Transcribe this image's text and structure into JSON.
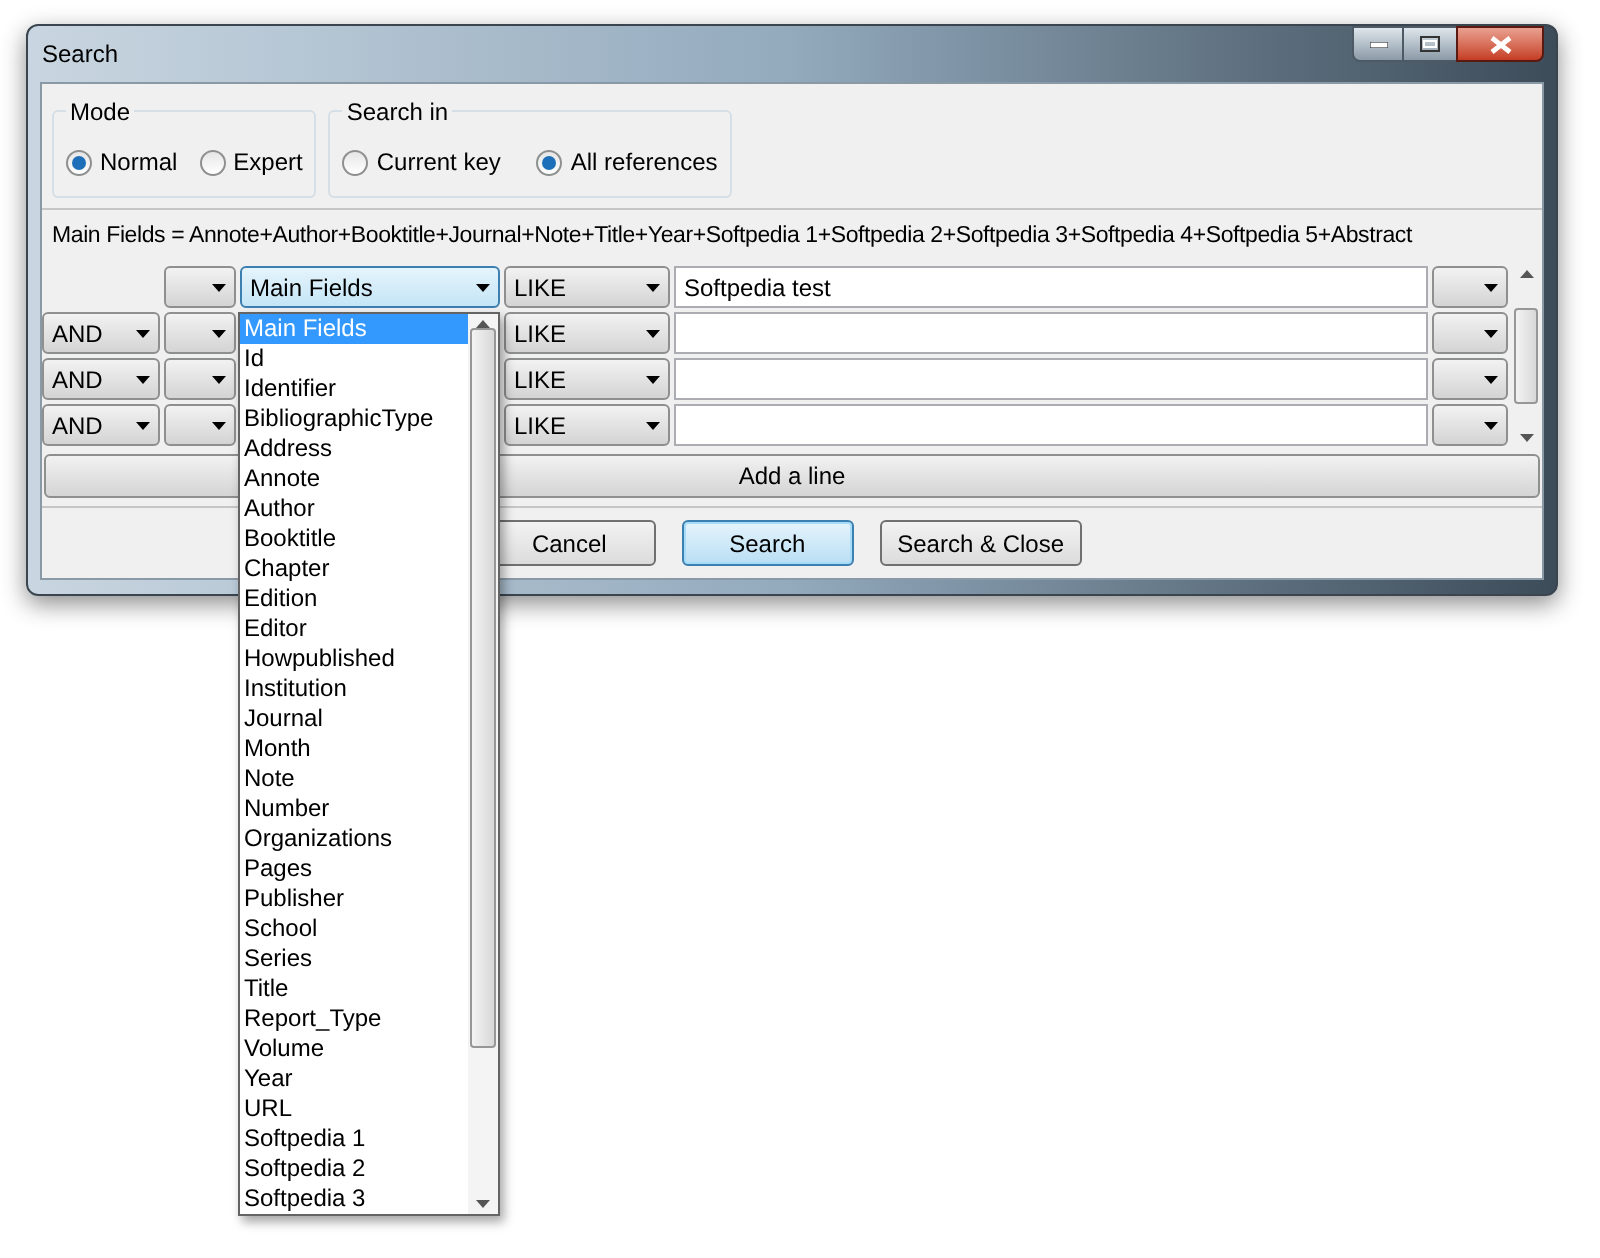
{
  "window": {
    "title": "Search"
  },
  "mode": {
    "label": "Mode",
    "options": [
      {
        "label": "Normal",
        "selected": true
      },
      {
        "label": "Expert",
        "selected": false
      }
    ]
  },
  "search_in": {
    "label": "Search in",
    "options": [
      {
        "label": "Current key",
        "selected": false
      },
      {
        "label": "All references",
        "selected": true
      }
    ]
  },
  "main_fields_line": "Main Fields = Annote+Author+Booktitle+Journal+Note+Title+Year+Softpedia 1+Softpedia 2+Softpedia 3+Softpedia 4+Softpedia 5+Abstract",
  "rows": [
    {
      "field": "Main Fields",
      "operator": "LIKE",
      "value": "Softpedia test",
      "dropdown": {
        "items": [
          {
            "label": "Main Fields",
            "selected": true
          },
          {
            "label": "Id",
            "selected": false
          },
          {
            "label": "Identifier",
            "selected": false
          },
          {
            "label": "BibliographicType",
            "selected": false
          },
          {
            "label": "Address",
            "selected": false
          },
          {
            "label": "Annote",
            "selected": false
          },
          {
            "label": "Author",
            "selected": false
          },
          {
            "label": "Booktitle",
            "selected": false
          },
          {
            "label": "Chapter",
            "selected": false
          },
          {
            "label": "Edition",
            "selected": false
          },
          {
            "label": "Editor",
            "selected": false
          },
          {
            "label": "Howpublished",
            "selected": false
          },
          {
            "label": "Institution",
            "selected": false
          },
          {
            "label": "Journal",
            "selected": false
          },
          {
            "label": "Month",
            "selected": false
          },
          {
            "label": "Note",
            "selected": false
          },
          {
            "label": "Number",
            "selected": false
          },
          {
            "label": "Organizations",
            "selected": false
          },
          {
            "label": "Pages",
            "selected": false
          },
          {
            "label": "Publisher",
            "selected": false
          },
          {
            "label": "School",
            "selected": false
          },
          {
            "label": "Series",
            "selected": false
          },
          {
            "label": "Title",
            "selected": false
          },
          {
            "label": "Report_Type",
            "selected": false
          },
          {
            "label": "Volume",
            "selected": false
          },
          {
            "label": "Year",
            "selected": false
          },
          {
            "label": "URL",
            "selected": false
          },
          {
            "label": "Softpedia 1",
            "selected": false
          },
          {
            "label": "Softpedia 2",
            "selected": false
          },
          {
            "label": "Softpedia 3",
            "selected": false
          }
        ]
      }
    },
    {
      "logic": "AND",
      "operator": "LIKE"
    },
    {
      "logic": "AND",
      "operator": "LIKE"
    },
    {
      "logic": "AND",
      "operator": "LIKE"
    }
  ],
  "add_line_button": "Add a line",
  "buttons": [
    {
      "label": "Cancel",
      "default": false
    },
    {
      "label": "Search",
      "default": true
    },
    {
      "label": "Search & Close",
      "default": false
    }
  ]
}
